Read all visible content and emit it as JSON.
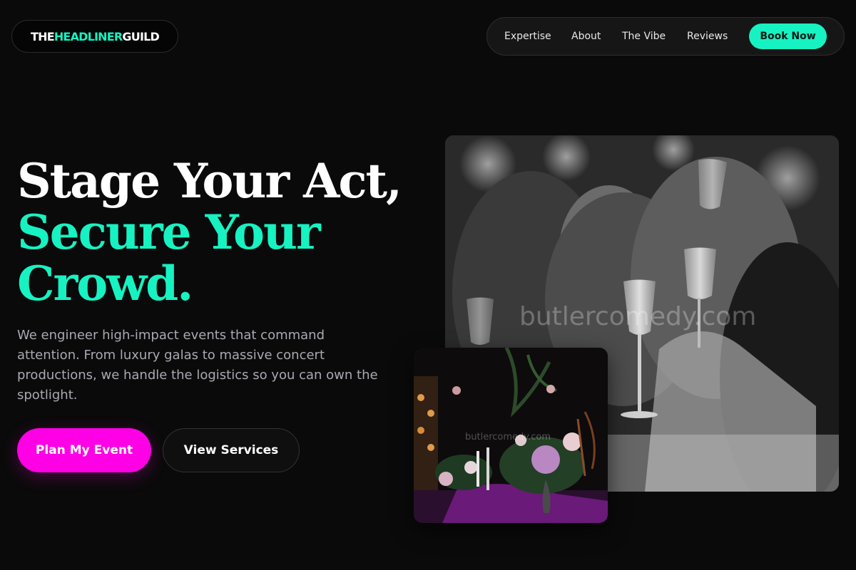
{
  "brand": {
    "part1": "THE ",
    "part2": "HEADLINER",
    "part3": " GUILD"
  },
  "nav": {
    "links": [
      "Expertise",
      "About",
      "The Vibe",
      "Reviews"
    ],
    "cta": "Book Now"
  },
  "hero": {
    "line1": "Stage Your Act,",
    "line2": "Secure Your",
    "line3": "Crowd.",
    "description": "We engineer high-impact events that command attention. From luxury galas to massive concert productions, we handle the logistics so you can own the spotlight.",
    "primary_cta": "Plan My Event",
    "secondary_cta": "View Services"
  },
  "images": {
    "main_watermark": "butlercomedy.com",
    "small_watermark": "butlercomedy.com"
  },
  "colors": {
    "background": "#0a0a0a",
    "accent": "#17f2c2",
    "primary_button": "#ff00e6",
    "body_text": "#a9a9b2"
  }
}
